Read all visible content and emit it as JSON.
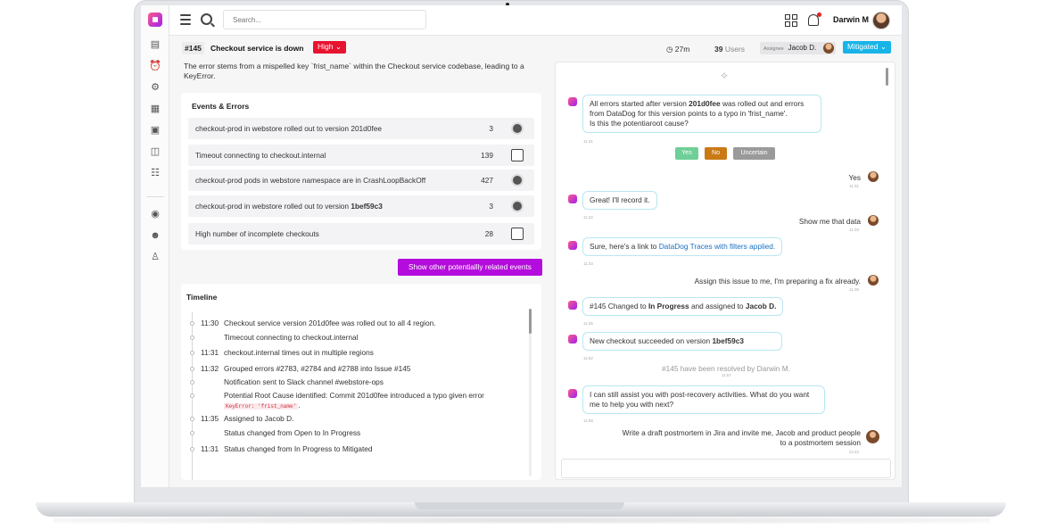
{
  "header": {
    "search_placeholder": "Search...",
    "user_name": "Darwin M"
  },
  "issue": {
    "id": "#145",
    "title": "Checkout service is down",
    "priority": "High",
    "duration": "27m",
    "users_count": "39",
    "users_label": "Users",
    "assignee_label": "Assignee",
    "assignee_name": "Jacob D.",
    "status": "Mitigated",
    "summary": "The error stems from a mispelled key `frist_name` within the  Checkout service codebase, leading to a KeyError."
  },
  "events": {
    "title": "Events & Errors",
    "rows": [
      {
        "text": "checkout-prod in webstore rolled out to version 201d0fee",
        "count": "3",
        "icon": "kubernetes-icon"
      },
      {
        "text": "Timeout connecting to checkout.internal",
        "count": "139",
        "icon": "datadog-icon"
      },
      {
        "text": "checkout-prod pods in webstore namespace are in CrashLoopBackOff",
        "count": "427",
        "icon": "kubernetes-icon"
      },
      {
        "text": "checkout-prod in webstore rolled out to version ",
        "text_bold": "1bef59c3",
        "count": "3",
        "icon": "kubernetes-icon"
      },
      {
        "text": "High number of incomplete checkouts",
        "count": "28",
        "icon": "datadog-icon"
      }
    ],
    "related_button": "Show other potentiallly related events"
  },
  "timeline": {
    "title": "Timeline",
    "rows": [
      {
        "time": "11:30",
        "text": "Checkout service version 201d0fee was rolled out to all 4 region."
      },
      {
        "time": "",
        "text": "Timecout connecting to checkout.internal"
      },
      {
        "time": "11:31",
        "text": "checkout.internal times out in multiple regions"
      },
      {
        "time": "11:32",
        "text": "Grouped errors #2783, #2784 and #2788 into Issue #145"
      },
      {
        "time": "",
        "text": "Notification sent to Slack channel #webstore-ops"
      },
      {
        "time": "",
        "text": "Potential Root Cause identified: Commit 201d0fee introduced a typo given error",
        "code": "KeyError: 'frist_name'",
        "suffix": "."
      },
      {
        "time": "11:35",
        "text": "Assigned to Jacob D."
      },
      {
        "time": "",
        "text": "Status changed from Open to In Progress"
      },
      {
        "time": "11:31",
        "text": "Status changed from In Progress to Mitigated"
      }
    ]
  },
  "chat": {
    "m1": {
      "pre": "All errors started after version ",
      "bold": "201d0fee",
      "post": " was rolled out and errors from DataDog for this version points to a typo in 'frist_name'.",
      "line3": "Is this the potentiaroot cause?",
      "time": "11:31"
    },
    "choices": {
      "yes": "Yes",
      "no": "No",
      "uncertain": "Uncertain"
    },
    "u1": {
      "text": "Yes",
      "time": "11:31"
    },
    "m2": {
      "text": "Great! I'll record it.",
      "time": "11:32"
    },
    "u2": {
      "text": "Show me that data",
      "time": "11:33"
    },
    "m3": {
      "pre": "Sure, here's a link to ",
      "link": "DataDog Traces with filters applied.",
      "time": "11:33"
    },
    "u3": {
      "text": "Assign this issue to me, I'm preparing a fix already.",
      "time": "11:35"
    },
    "m4": {
      "pre": "#145 Changed to ",
      "b1": "In Progress",
      "mid": " and assigned to ",
      "b2": "Jacob D.",
      "time": "11:35"
    },
    "m5": {
      "pre": "New checkout succeeded on version ",
      "bold": "1bef59c3",
      "time": "11:52"
    },
    "sys": {
      "text": "#145 have been resolved by Darwin M.",
      "time": "11:57"
    },
    "m6": {
      "text": "I can still assist you with post-recovery activities. What do you want me to help you with next?",
      "time": "11:58"
    },
    "u4": {
      "text": "Write a draft postmortem in Jira and invite me, Jacob and product people to a postmortem session",
      "time": "12:42"
    }
  },
  "colors": {
    "priority": "#e8132f",
    "status": "#18b4e8",
    "related_button": "#b40cdc",
    "yes": "#6fcf97",
    "no": "#c97a14",
    "uncertain": "#9a9a9a"
  }
}
